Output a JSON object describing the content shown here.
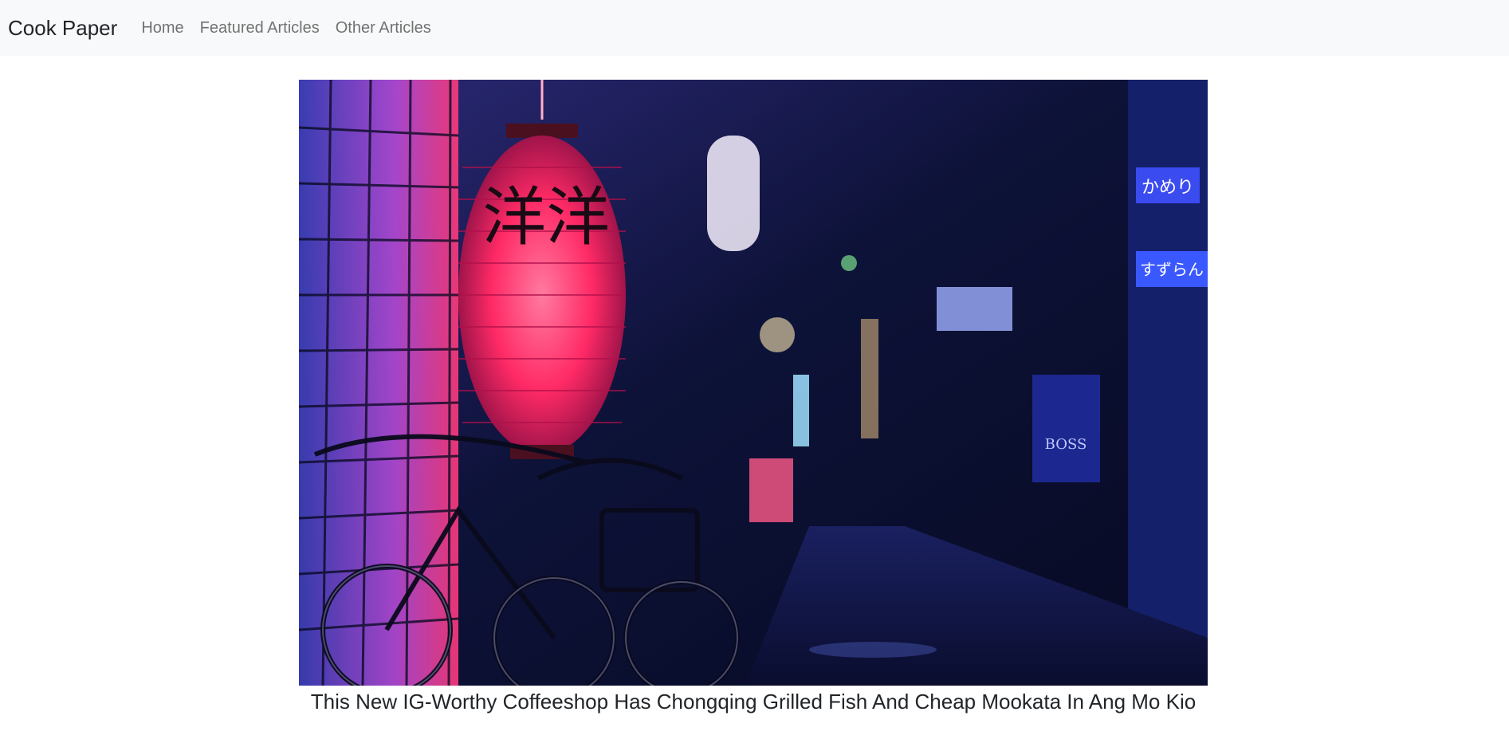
{
  "navbar": {
    "brand": "Cook Paper",
    "links": [
      "Home",
      "Featured Articles",
      "Other Articles"
    ]
  },
  "article": {
    "title": "This New IG-Worthy Coffeeshop Has Chongqing Grilled Fish And Cheap Mookata In Ang Mo Kio",
    "image": {
      "icon": "article-hero-image",
      "lantern_text": "洋洋",
      "sign_text_1": "かめり",
      "sign_text_2": "すずらん",
      "sign_text_3": "BOSS"
    }
  },
  "colors": {
    "navbar_bg": "#f8f9fa",
    "lantern": "#ff2a66",
    "night_blue": "#1b1f66"
  }
}
